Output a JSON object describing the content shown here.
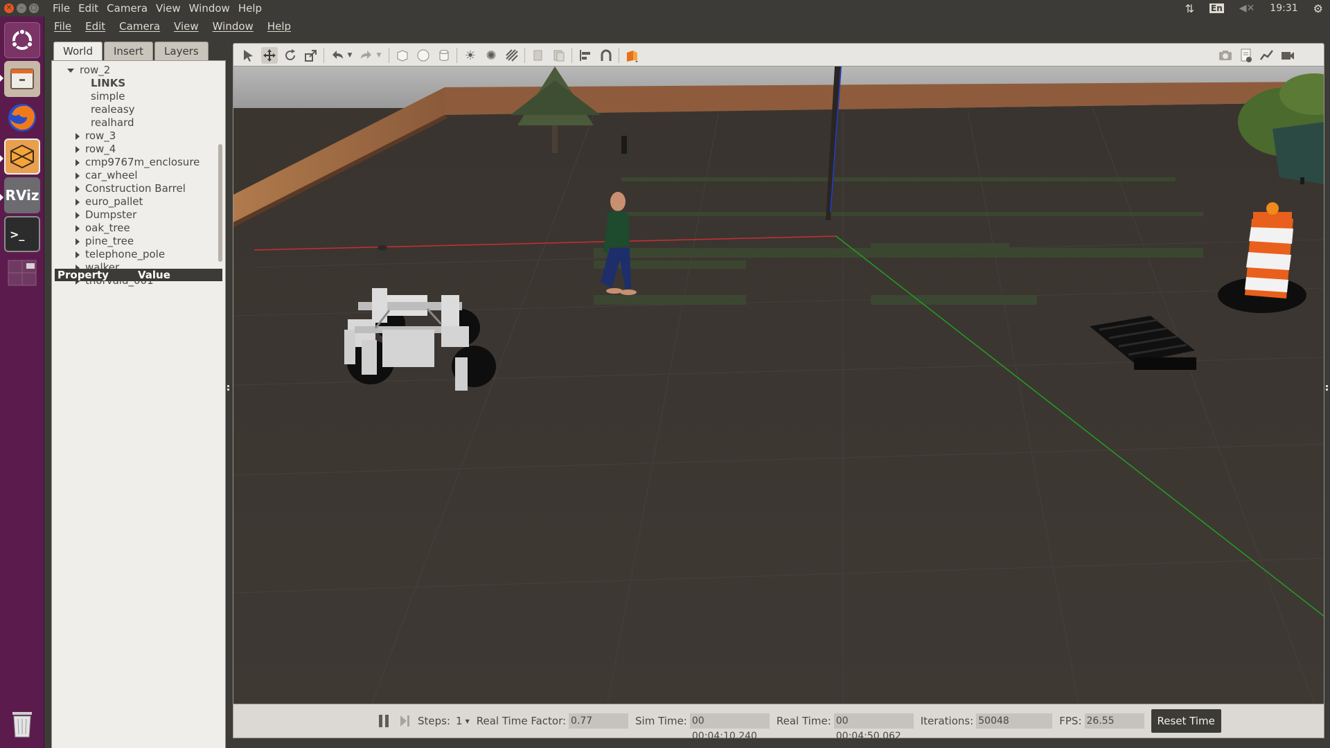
{
  "system_bar": {
    "menu": [
      "File",
      "Edit",
      "Camera",
      "View",
      "Window",
      "Help"
    ],
    "keyboard_layout": "En",
    "clock": "19:31"
  },
  "launcher": {
    "items": [
      {
        "name": "ubuntu-dash",
        "icon": "ubuntu-logo-icon"
      },
      {
        "name": "files",
        "icon": "file-cabinet-icon"
      },
      {
        "name": "firefox",
        "icon": "firefox-icon"
      },
      {
        "name": "gazebo",
        "icon": "gazebo-icon"
      },
      {
        "name": "rviz",
        "label": "RViz",
        "icon": "rviz-icon"
      },
      {
        "name": "terminal",
        "label": ">_",
        "icon": "terminal-icon"
      },
      {
        "name": "workspace-switcher",
        "icon": "workspaces-icon"
      },
      {
        "name": "trash",
        "icon": "trash-icon"
      }
    ]
  },
  "app_menu": [
    "File",
    "Edit",
    "Camera",
    "View",
    "Window",
    "Help"
  ],
  "left_panel": {
    "tabs": [
      "World",
      "Insert",
      "Layers"
    ],
    "active_tab": "World",
    "tree": [
      {
        "label": "row_2",
        "level": 0,
        "expanded": true
      },
      {
        "label": "LINKS",
        "level": 1,
        "bold": true
      },
      {
        "label": "simple",
        "level": 1
      },
      {
        "label": "realeasy",
        "level": 1
      },
      {
        "label": "realhard",
        "level": 1
      },
      {
        "label": "row_3",
        "level": 0,
        "expanded": false
      },
      {
        "label": "row_4",
        "level": 0,
        "expanded": false
      },
      {
        "label": "cmp9767m_enclosure",
        "level": 0,
        "expanded": false
      },
      {
        "label": "car_wheel",
        "level": 0,
        "expanded": false
      },
      {
        "label": "Construction Barrel",
        "level": 0,
        "expanded": false
      },
      {
        "label": "euro_pallet",
        "level": 0,
        "expanded": false
      },
      {
        "label": "Dumpster",
        "level": 0,
        "expanded": false
      },
      {
        "label": "oak_tree",
        "level": 0,
        "expanded": false
      },
      {
        "label": "pine_tree",
        "level": 0,
        "expanded": false
      },
      {
        "label": "telephone_pole",
        "level": 0,
        "expanded": false
      },
      {
        "label": "walker",
        "level": 0,
        "expanded": false
      },
      {
        "label": "thorvald_001",
        "level": 0,
        "expanded": false
      }
    ],
    "property_header": {
      "property": "Property",
      "value": "Value"
    }
  },
  "toolbar": {
    "icons": [
      "select-arrow-icon",
      "translate-icon",
      "rotate-icon",
      "scale-icon",
      "undo-icon",
      "undo-dropdown-icon",
      "redo-icon",
      "redo-dropdown-icon",
      "box-shape-icon",
      "sphere-shape-icon",
      "cylinder-shape-icon",
      "point-light-icon",
      "spot-light-icon",
      "directional-light-icon",
      "copy-icon",
      "paste-icon",
      "align-icon",
      "snap-icon",
      "view-angle-icon",
      "screenshot-icon",
      "log-icon",
      "plot-icon",
      "record-icon"
    ]
  },
  "bottom_bar": {
    "steps_label": "Steps:",
    "steps_value": "1",
    "rtf_label": "Real Time Factor:",
    "rtf_value": "0.77",
    "sim_time_label": "Sim Time:",
    "sim_time_value": "00 00:04:10.240",
    "real_time_label": "Real Time:",
    "real_time_value": "00 00:04:50.062",
    "iterations_label": "Iterations:",
    "iterations_value": "50048",
    "fps_label": "FPS:",
    "fps_value": "26.55",
    "reset_label": "Reset Time"
  },
  "colors": {
    "launcher_bg": "#5b1c4d",
    "panel_bg": "#3c3b37",
    "ground": "#3b3530",
    "wall": "#8a5a3a",
    "barrel_orange": "#e8601c",
    "axis_red": "#c83030",
    "axis_green": "#22a020",
    "axis_blue": "#2040d0"
  }
}
